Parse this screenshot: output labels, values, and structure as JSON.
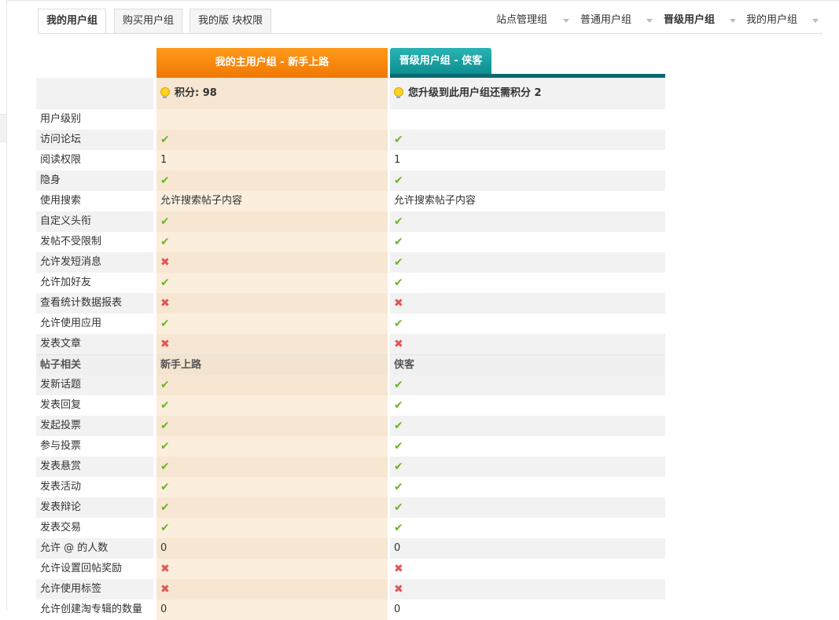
{
  "tabs": [
    {
      "label": "我的用户组",
      "active": true
    },
    {
      "label": "购买用户组",
      "active": false
    },
    {
      "label": "我的版 块权限",
      "active": false
    }
  ],
  "topnav": [
    {
      "label": "站点管理组",
      "bold": false
    },
    {
      "label": "普通用户组",
      "bold": false
    },
    {
      "label": "晋级用户组",
      "bold": true
    },
    {
      "label": "我的用户组",
      "bold": false
    }
  ],
  "columns": {
    "col1_header": "我的主用户组 - 新手上路",
    "col2_header": "晋级用户组 - 侠客",
    "col1_info": "积分: 98",
    "col2_info": "您升级到此用户组还需积分 2"
  },
  "colors": {
    "orange": "#f07805",
    "teal": "#0d8f91",
    "check": "#6cb52a",
    "cross": "#e25555"
  },
  "rows": [
    {
      "label": "用户级别",
      "v1": "",
      "v2": ""
    },
    {
      "label": "访问论坛",
      "v1": "✔",
      "v2": "✔"
    },
    {
      "label": "阅读权限",
      "v1": "1",
      "v2": "1"
    },
    {
      "label": "隐身",
      "v1": "✔",
      "v2": "✔"
    },
    {
      "label": "使用搜索",
      "v1": "允许搜索帖子内容",
      "v2": "允许搜索帖子内容"
    },
    {
      "label": "自定义头衔",
      "v1": "✔",
      "v2": "✔"
    },
    {
      "label": "发帖不受限制",
      "v1": "✔",
      "v2": "✔"
    },
    {
      "label": "允许发短消息",
      "v1": "✖",
      "v2": "✔"
    },
    {
      "label": "允许加好友",
      "v1": "✔",
      "v2": "✔"
    },
    {
      "label": "查看统计数据报表",
      "v1": "✖",
      "v2": "✖"
    },
    {
      "label": "允许使用应用",
      "v1": "✔",
      "v2": "✔"
    },
    {
      "label": "发表文章",
      "v1": "✖",
      "v2": "✖"
    },
    {
      "label": "帖子相关",
      "v1": "新手上路",
      "v2": "侠客",
      "section": true
    },
    {
      "label": "发新话题",
      "v1": "✔",
      "v2": "✔"
    },
    {
      "label": "发表回复",
      "v1": "✔",
      "v2": "✔"
    },
    {
      "label": "发起投票",
      "v1": "✔",
      "v2": "✔"
    },
    {
      "label": "参与投票",
      "v1": "✔",
      "v2": "✔"
    },
    {
      "label": "发表悬赏",
      "v1": "✔",
      "v2": "✔"
    },
    {
      "label": "发表活动",
      "v1": "✔",
      "v2": "✔"
    },
    {
      "label": "发表辩论",
      "v1": "✔",
      "v2": "✔"
    },
    {
      "label": "发表交易",
      "v1": "✔",
      "v2": "✔"
    },
    {
      "label": "允许 @ 的人数",
      "v1": "0",
      "v2": "0"
    },
    {
      "label": "允许设置回帖奖励",
      "v1": "✖",
      "v2": "✖"
    },
    {
      "label": "允许使用标签",
      "v1": "✖",
      "v2": "✖"
    },
    {
      "label": "允许创建淘专辑的数量",
      "v1": "0",
      "v2": "0"
    }
  ]
}
